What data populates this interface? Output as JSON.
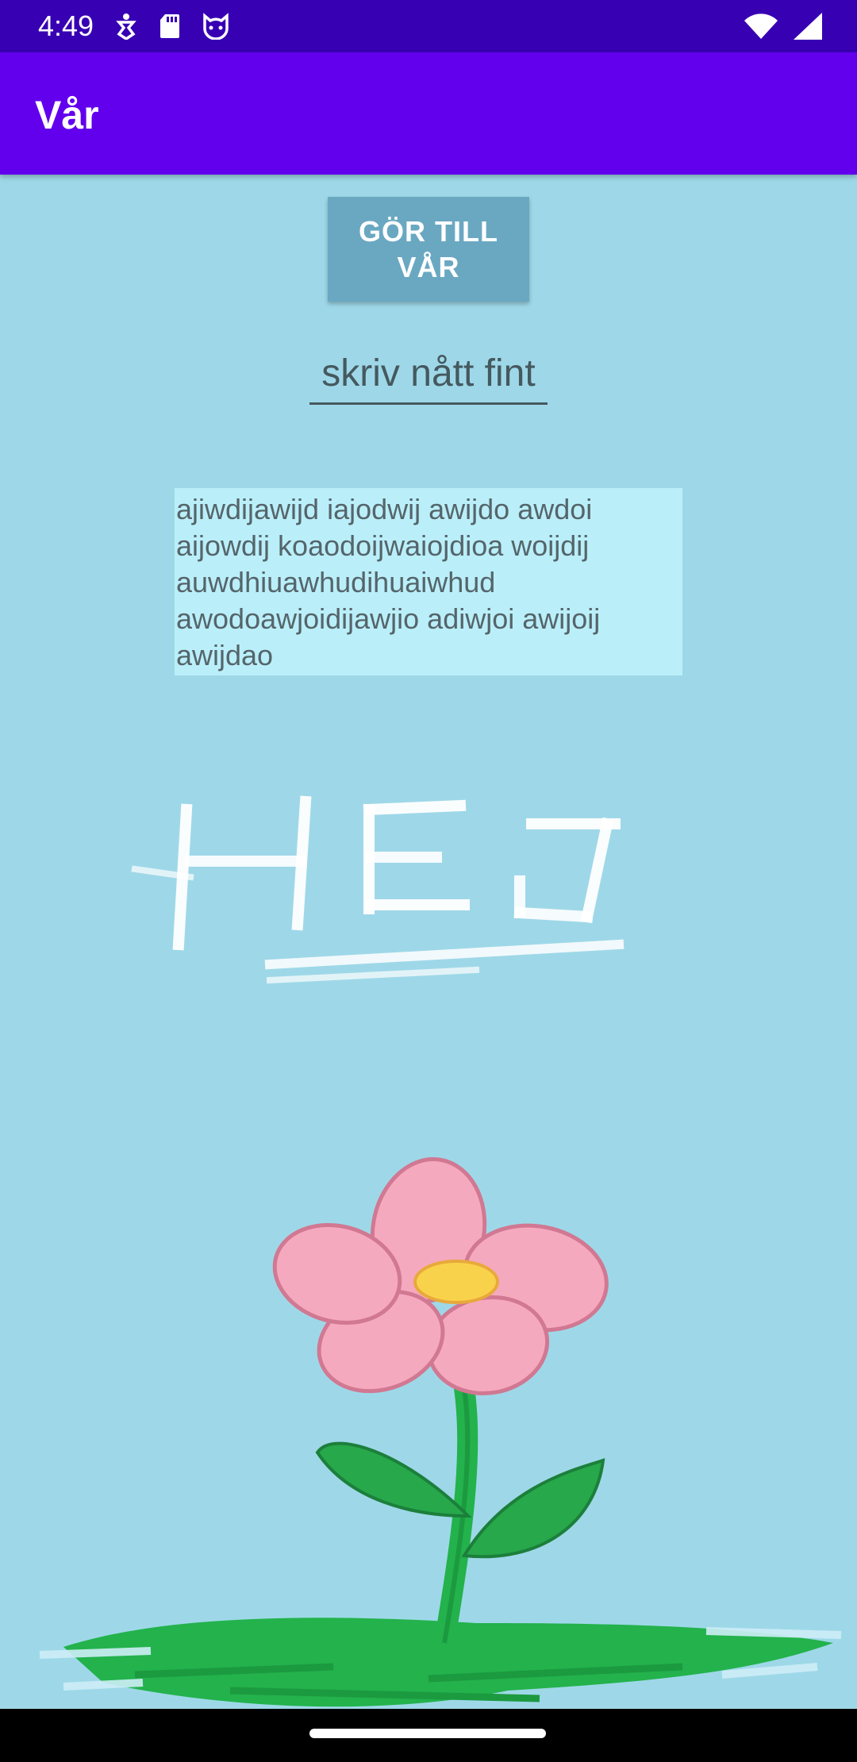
{
  "status_bar": {
    "time": "4:49",
    "left_icons": [
      "accessibility-icon",
      "sd-card-icon",
      "cat-face-icon"
    ],
    "right_icons": [
      "wifi-icon",
      "cell-signal-icon"
    ]
  },
  "app_bar": {
    "title": "Vår"
  },
  "main": {
    "button_label": "GÖR TILL VÅR",
    "input_placeholder": "skriv nått fint",
    "input_value": "",
    "paragraph": "ajiwdijawijd iajodwij awijdo awdoi aijowdij koaodoijwaiojdioa woijdij auwdhiuawhudihuaiwhud awodoawjoidijawjio adiwjoi awijoij awijdao",
    "artwork_text": "HEJ"
  },
  "colors": {
    "status_bar": "#3700b3",
    "app_bar": "#6200ee",
    "background": "#9ed8e8",
    "button": "#6aa8c2",
    "text_box": "#baeffa",
    "nav_bar": "#000000"
  }
}
